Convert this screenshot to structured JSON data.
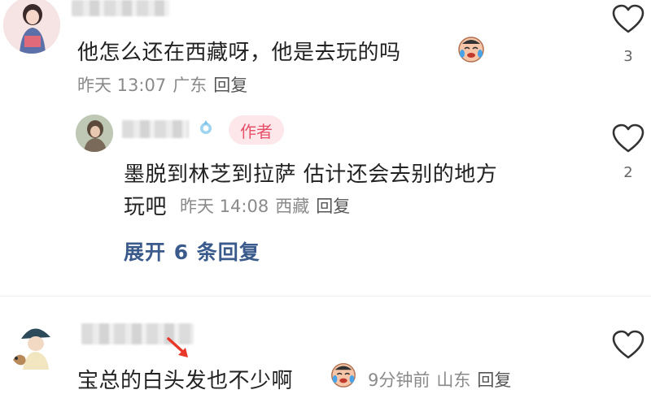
{
  "comment1": {
    "text": "他怎么还在西藏呀，他是去玩的吗",
    "time": "昨天 13:07",
    "location": "广东",
    "reply_label": "回复",
    "likes": "3"
  },
  "reply1": {
    "author_badge": "作者",
    "text_line1": "墨脱到林芝到拉萨 估计还会去别的地方",
    "text_line2": "玩吧",
    "time": "昨天 14:08",
    "location": "西藏",
    "reply_label": "回复",
    "likes": "2"
  },
  "expand_label": "展开 6 条回复",
  "comment2": {
    "text": "宝总的白头发也不少啊",
    "time": "9分钟前",
    "location": "山东",
    "reply_label": "回复"
  },
  "colors": {
    "author_badge_bg": "#fde7ea",
    "author_badge_text": "#e8506a",
    "expand_link": "#3a5a8c",
    "meta_text": "#8a8a8a"
  }
}
